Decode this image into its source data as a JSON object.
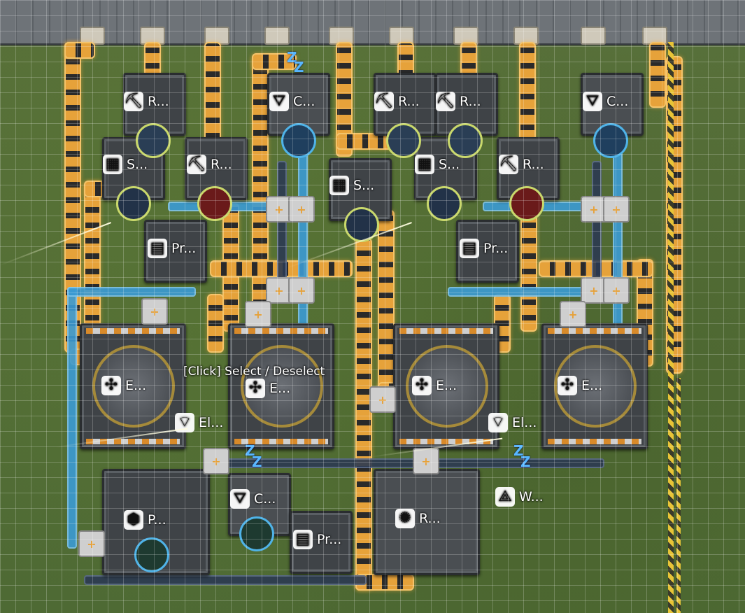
{
  "tooltip": "[Click] Select / Deselect",
  "sleep_indicator": "Z",
  "machines": {
    "refinery_1": {
      "label": "R...",
      "icon": "⛏"
    },
    "refinery_2": {
      "label": "R...",
      "icon": "⛏"
    },
    "refinery_3": {
      "label": "R...",
      "icon": "⛏"
    },
    "refinery_4": {
      "label": "R...",
      "icon": "⛏"
    },
    "refinery_5": {
      "label": "R...",
      "icon": "⛏"
    },
    "collector_1": {
      "label": "C...",
      "icon": "⛛"
    },
    "collector_2": {
      "label": "C...",
      "icon": "⛛"
    },
    "collector_3": {
      "label": "C...",
      "icon": "⛛"
    },
    "shredder_1": {
      "label": "S...",
      "icon": "▦"
    },
    "shredder_2": {
      "label": "S...",
      "icon": "▦"
    },
    "shredder_3": {
      "label": "S...",
      "icon": "▦"
    },
    "packer_1": {
      "label": "Pr...",
      "icon": "▤"
    },
    "packer_2": {
      "label": "Pr...",
      "icon": "▤"
    },
    "packer_3": {
      "label": "Pr...",
      "icon": "▤"
    },
    "electric_1": {
      "label": "E...",
      "icon": "✣"
    },
    "electric_2": {
      "label": "E...",
      "icon": "✣"
    },
    "electric_3": {
      "label": "E...",
      "icon": "✣"
    },
    "electric_4": {
      "label": "E...",
      "icon": "✣"
    },
    "relay_1": {
      "label": "El...",
      "icon": "⌔"
    },
    "relay_2": {
      "label": "El...",
      "icon": "⌔"
    },
    "pump_1": {
      "label": "P...",
      "icon": "⬢"
    },
    "reactor_1": {
      "label": "R...",
      "icon": "✺"
    },
    "water_1": {
      "label": "W...",
      "icon": "⟁"
    }
  },
  "colors": {
    "grass": "#5f7a3a",
    "belt": "#e6a23a",
    "pipe": "#3b9bd4",
    "rail": "#e8c437",
    "ore_ring": "#c9d86b",
    "fluid_ring": "#4fb3e8"
  }
}
